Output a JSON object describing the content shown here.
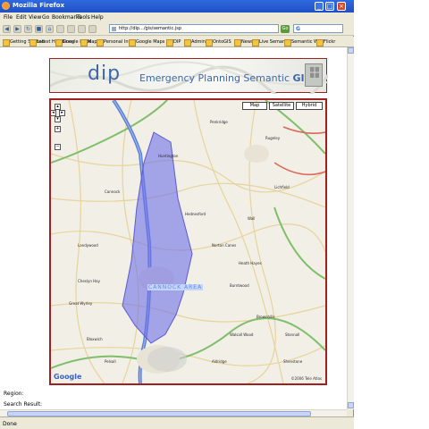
{
  "window": {
    "title": "Mozilla Firefox",
    "min_glyph": "_",
    "max_glyph": "□",
    "close_glyph": "×"
  },
  "menu": [
    "File",
    "Edit",
    "View",
    "Go",
    "Bookmarks",
    "Tools",
    "Help"
  ],
  "nav": {
    "back_glyph": "◀",
    "forward_glyph": "▶",
    "reload_glyph": "↻",
    "stop_glyph": "■",
    "home_glyph": "⌂",
    "url": "http://dip.../gis/semantic.jsp",
    "go_label": "Go",
    "search_glyph": "G"
  },
  "bookmarks": [
    "Getting Started",
    "Latest Headlines",
    "Google Maps",
    "Map",
    "Personal Info",
    "Google Maps API",
    "DIP",
    "Admin",
    "OntoGIS",
    "News",
    "Live Semantic",
    "Semantic Web",
    "Flickr"
  ],
  "banner": {
    "logo_text": "dip",
    "title_prefix": "Emergency Planning Semantic ",
    "title_gis": "GIS",
    "partner_logo": "ordnance-survey-logo"
  },
  "map": {
    "type_buttons": [
      "Map",
      "Satellite",
      "Hybrid"
    ],
    "zoom_in": "+",
    "zoom_out": "−",
    "region_label": "CANNOCK AREA",
    "google_logo": "Google",
    "copyright": "©2006 Tele Atlas",
    "polygon_color": "#6f6fe8",
    "road_color": "#5c7fd6",
    "towns": [
      "Penkridge",
      "Huntington",
      "Cannock",
      "Hednesford",
      "Norton Canes",
      "Heath Hayes",
      "Brownhills",
      "Walsall Wood",
      "Cheslyn Hay",
      "Great Wyrley",
      "Bloxwich",
      "Rugeley",
      "Lichfield",
      "Burntwood",
      "Shenstone",
      "Aldridge",
      "Pelsall",
      "Landywood",
      "Wall",
      "Stonnall"
    ]
  },
  "page": {
    "line1": "Region:",
    "line2": "Search Result:"
  },
  "status": "Done"
}
